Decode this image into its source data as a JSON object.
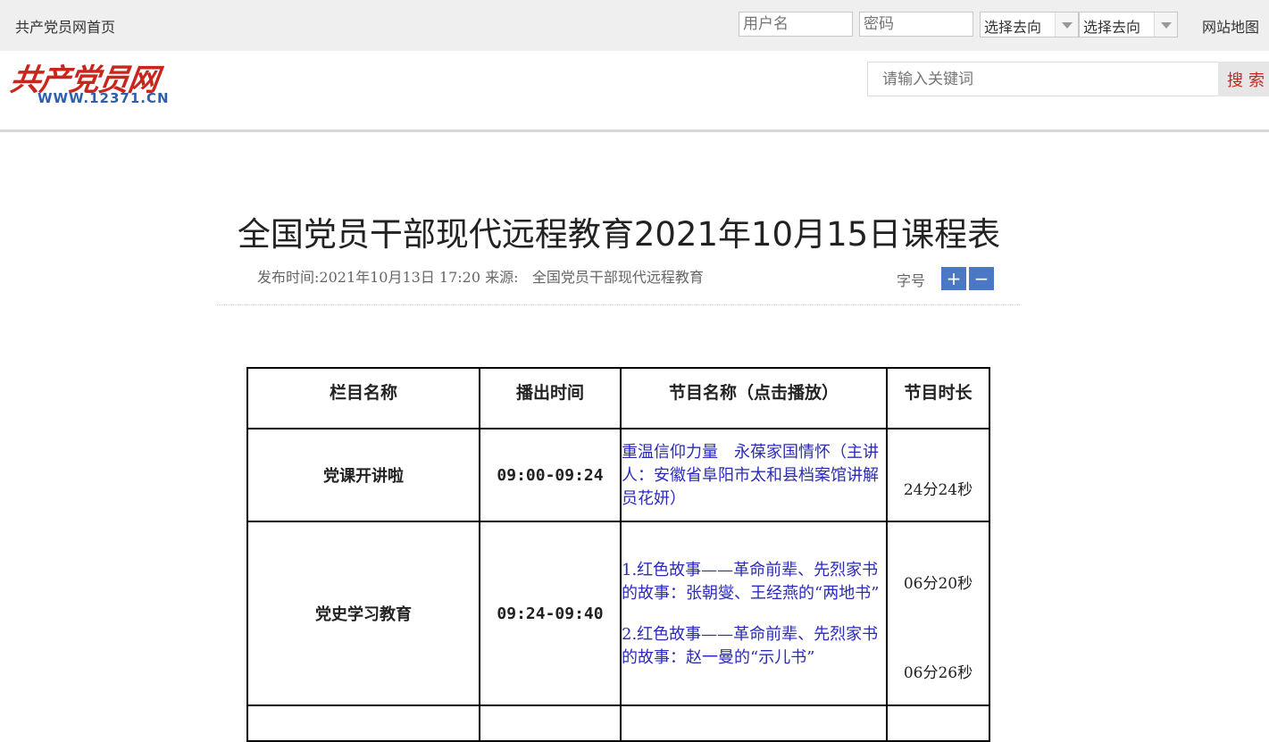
{
  "topbar": {
    "home_link": "共产党员网首页",
    "username_placeholder": "用户名",
    "password_placeholder": "密码",
    "select_1_value": "选择去向",
    "select_2_value": "选择去向",
    "sitemap_link": "网站地图"
  },
  "header": {
    "logo_text": "共产党员网",
    "logo_url": "WWW.12371.CN",
    "search_placeholder": "请输入关键词",
    "search_button": "搜索"
  },
  "article": {
    "title": "全国党员干部现代远程教育2021年10月15日课程表",
    "publish_label": "发布时间:",
    "publish_time": "2021年10月13日 17:20",
    "source_label": "来源:",
    "source": "全国党员干部现代远程教育",
    "font_size_label": "字号",
    "font_plus": "+",
    "font_minus": "−"
  },
  "table": {
    "headers": [
      "栏目名称",
      "播出时间",
      "节目名称（点击播放）",
      "节目时长"
    ],
    "rows": [
      {
        "column": "党课开讲啦",
        "time": "09:00-09:24",
        "programs": [
          "重温信仰力量　永葆家国情怀（主讲人：安徽省阜阳市太和县档案馆讲解员花妍）"
        ],
        "durations": [
          "24分24秒"
        ]
      },
      {
        "column": "党史学习教育",
        "time": "09:24-09:40",
        "programs": [
          "1.红色故事——革命前辈、先烈家书的故事：张朝燮、王经燕的“两地书”",
          "2.红色故事——革命前辈、先烈家书的故事：赵一曼的“示儿书”"
        ],
        "durations": [
          "06分20秒",
          "06分26秒"
        ]
      }
    ]
  }
}
